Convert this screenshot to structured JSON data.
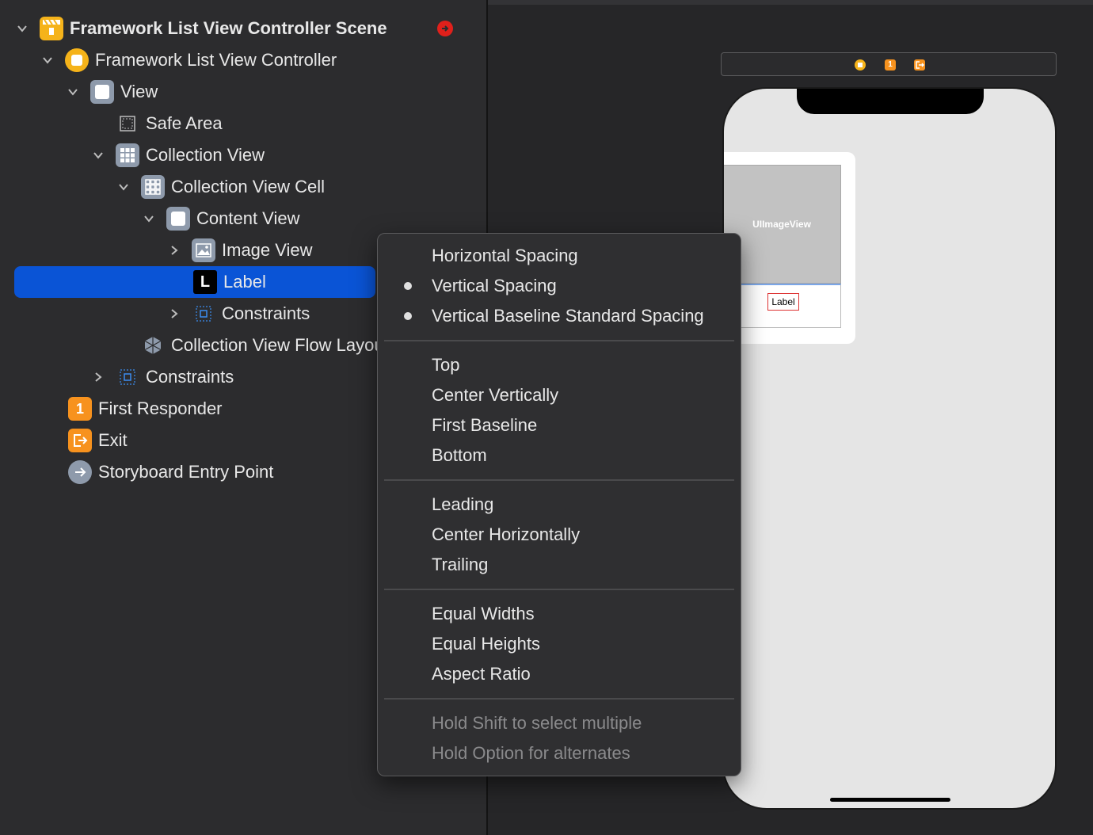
{
  "outline": {
    "items": [
      {
        "label": "Framework List View Controller Scene",
        "icon": "scene-icon",
        "expanded": true,
        "has_warning": true
      },
      {
        "label": "Framework List View Controller",
        "icon": "view-controller-icon",
        "expanded": true
      },
      {
        "label": "View",
        "icon": "view-icon",
        "expanded": true
      },
      {
        "label": "Safe Area",
        "icon": "safe-area-icon"
      },
      {
        "label": "Collection View",
        "icon": "collection-view-icon",
        "expanded": true
      },
      {
        "label": "Collection View Cell",
        "icon": "collection-view-cell-icon",
        "expanded": true
      },
      {
        "label": "Content View",
        "icon": "content-view-icon",
        "expanded": true
      },
      {
        "label": "Image View",
        "icon": "image-view-icon",
        "expanded": false
      },
      {
        "label": "Label",
        "icon": "label-icon",
        "selected": true
      },
      {
        "label": "Constraints",
        "icon": "constraints-icon",
        "expanded": false
      },
      {
        "label": "Collection View Flow Layout",
        "icon": "flow-layout-icon"
      },
      {
        "label": "Constraints",
        "icon": "constraints-icon",
        "expanded": false
      },
      {
        "label": "First Responder",
        "icon": "first-responder-icon"
      },
      {
        "label": "Exit",
        "icon": "exit-icon"
      },
      {
        "label": "Storyboard Entry Point",
        "icon": "entry-point-icon"
      }
    ]
  },
  "menu": {
    "groups": [
      [
        {
          "label": "Horizontal Spacing",
          "checked": false
        },
        {
          "label": "Vertical Spacing",
          "checked": true
        },
        {
          "label": "Vertical Baseline Standard Spacing",
          "checked": true
        }
      ],
      [
        {
          "label": "Top"
        },
        {
          "label": "Center Vertically"
        },
        {
          "label": "First Baseline"
        },
        {
          "label": "Bottom"
        }
      ],
      [
        {
          "label": "Leading"
        },
        {
          "label": "Center Horizontally"
        },
        {
          "label": "Trailing"
        }
      ],
      [
        {
          "label": "Equal Widths"
        },
        {
          "label": "Equal Heights"
        },
        {
          "label": "Aspect Ratio"
        }
      ],
      [
        {
          "label": "Hold Shift to select multiple",
          "disabled": true
        },
        {
          "label": "Hold Option for alternates",
          "disabled": true
        }
      ]
    ]
  },
  "canvas": {
    "image_view_label": "UIImageView",
    "label_preview": "Label",
    "scene_dock_icons": [
      "view-controller-icon",
      "first-responder-icon",
      "exit-icon"
    ]
  },
  "colors": {
    "selection": "#0a54d6",
    "orange": "#f7921e",
    "yellow": "#f5b31a",
    "warning_red": "#e0201b"
  }
}
